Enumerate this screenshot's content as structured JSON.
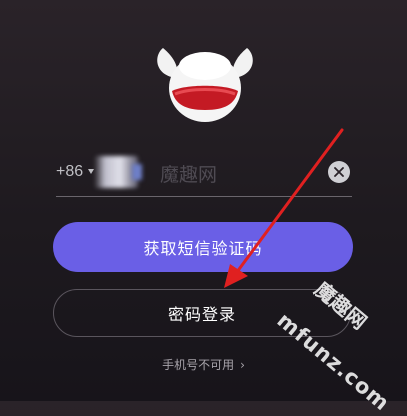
{
  "login": {
    "country_code": "+86",
    "phone_placeholder": "魔趣网",
    "sms_button_label": "获取短信验证码",
    "password_button_label": "密码登录",
    "phone_unavailable_label": "手机号不可用",
    "chevron": "›"
  },
  "watermark": {
    "brand": "mfunz.com",
    "brand_cn": "魔趣网"
  },
  "icons": {
    "logo": "bull-mascot-logo",
    "clear": "clear-icon",
    "country_caret": "caret-down-icon",
    "arrow": "red-arrow-annotation"
  },
  "colors": {
    "background_top": "#2a2329",
    "background_bottom": "#17141a",
    "primary_button": "#6a5fe6",
    "outline_button_border": "#5a555d",
    "annotation_arrow": "#e02020"
  }
}
